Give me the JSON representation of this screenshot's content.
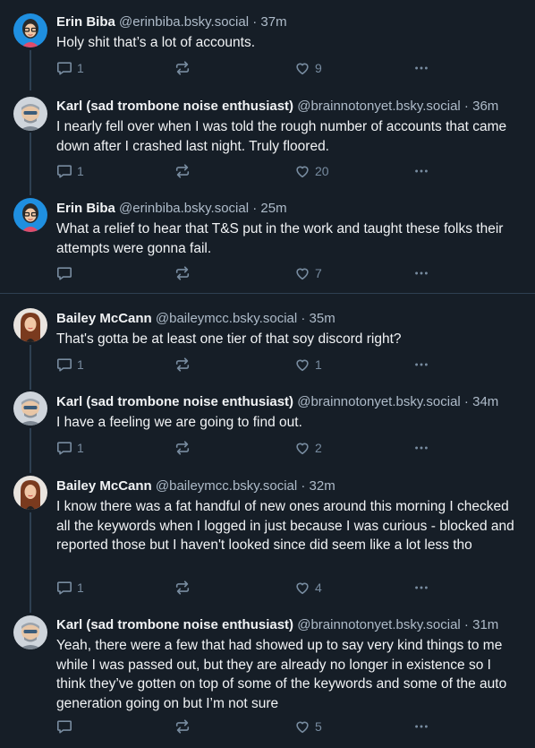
{
  "posts": [
    {
      "author": "Erin Biba",
      "handle": "@erinbiba.bsky.social",
      "time": "37m",
      "text": "Holy shit that’s a lot of accounts.",
      "replies": "1",
      "likes": "9",
      "avatar_icon": "erin-avatar"
    },
    {
      "author": "Karl (sad trombone noise enthusiast)",
      "handle": "@brainnotonyet.bsky.social",
      "time": "36m",
      "text": "I nearly fell over when I was told the rough number of accounts that came down after I crashed last night. Truly floored.",
      "replies": "1",
      "likes": "20",
      "avatar_icon": "karl-avatar"
    },
    {
      "author": "Erin Biba",
      "handle": "@erinbiba.bsky.social",
      "time": "25m",
      "text": "What a relief to hear that T&S put in the work and taught these folks their attempts were gonna fail.",
      "replies": "",
      "likes": "7",
      "avatar_icon": "erin-avatar"
    },
    {
      "author": "Bailey McCann",
      "handle": "@baileymcc.bsky.social",
      "time": "35m",
      "text": "That's gotta be at least one tier of that soy discord right?",
      "replies": "1",
      "likes": "1",
      "avatar_icon": "bailey-avatar"
    },
    {
      "author": "Karl (sad trombone noise enthusiast)",
      "handle": "@brainnotonyet.bsky.social",
      "time": "34m",
      "text": "I have a feeling we are going to find out.",
      "replies": "1",
      "likes": "2",
      "avatar_icon": "karl-avatar"
    },
    {
      "author": "Bailey McCann",
      "handle": "@baileymcc.bsky.social",
      "time": "32m",
      "text": "I know there was a fat handful of new ones around this morning I checked all the keywords when I logged in just because I was curious - blocked and reported those but I haven't looked since did seem like a lot less tho",
      "replies": "1",
      "likes": "4",
      "avatar_icon": "bailey-avatar"
    },
    {
      "author": "Karl (sad trombone noise enthusiast)",
      "handle": "@brainnotonyet.bsky.social",
      "time": "31m",
      "text": "Yeah, there were a few that had showed up to say very kind things to me while I was passed out, but they are already no longer in existence so I think they’ve gotten on top of some of the keywords and some of the auto generation going on but I’m not sure",
      "replies": "",
      "likes": "5",
      "avatar_icon": "karl-avatar"
    }
  ],
  "separator": " · ",
  "colors": {
    "background": "#161e27",
    "text": "#f1f3f5",
    "muted": "#788ca0",
    "handle": "#aebbc9",
    "thread_line": "#2e4052"
  }
}
